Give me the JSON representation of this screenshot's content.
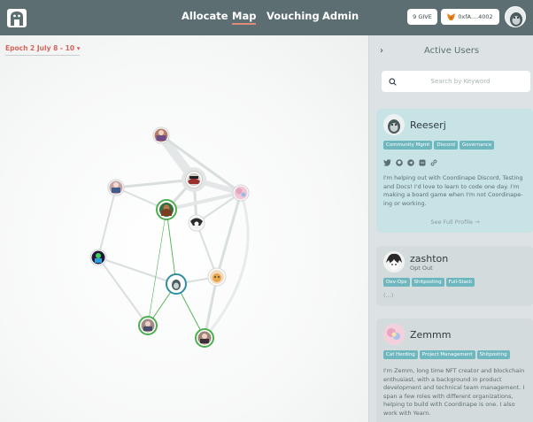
{
  "nav": {
    "items": [
      "Allocate",
      "Map",
      "Vouching",
      "Admin"
    ],
    "active": "Map"
  },
  "header": {
    "give_label": "9 GIVE",
    "wallet_label": "0xfA....4002"
  },
  "epoch": {
    "selected": "Epoch 2 July 8 - 10"
  },
  "panel": {
    "title": "Active Users",
    "search_placeholder": "Search by Keyword"
  },
  "users": [
    {
      "name": "Reeserj",
      "tags": [
        "Community Mgmt",
        "Discord",
        "Governance"
      ],
      "bio": "I'm helping out with Coordinape Discord, Testing and Docs! I'd love to learn to code one day. I'm making a board game when I'm not Coordinape-ing or working.",
      "see_profile": "See Full Profile →",
      "socials": [
        "twitter-icon",
        "github-icon",
        "telegram-icon",
        "discord-icon",
        "link-icon"
      ]
    },
    {
      "name": "zashton",
      "status": "Opt Out",
      "tags": [
        "Dev-Ops",
        "Shitposting",
        "Full-Stack"
      ],
      "ellipsis": "(...)"
    },
    {
      "name": "Zemmm",
      "tags": [
        "Cat Herding",
        "Project Management",
        "Shitposting"
      ],
      "bio": "I'm Zemm, long time NFT creator and blockchain enthusiast, with a background in product development and technical team management. I span a few roles with different organizations, helping to build with Coordinape is one. I also work with Yearn."
    }
  ],
  "colors": {
    "header_bg": "#5c6e72",
    "accent_epoch": "#d5645a",
    "tag_bg": "#6fb7bf",
    "selected_card": "#c7e3e5",
    "panel_bg": "#dde3e4",
    "edge_active": "#4caf50",
    "node_selected_ring": "#2f8fa0"
  }
}
